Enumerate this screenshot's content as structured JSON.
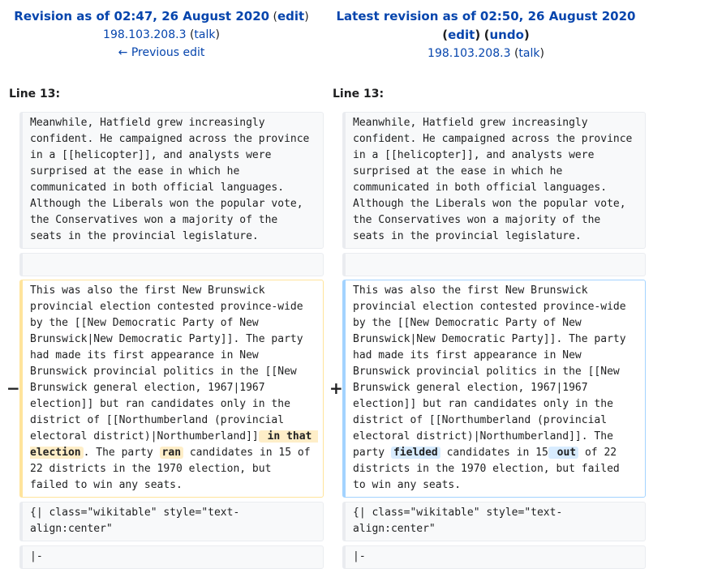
{
  "old_revision": {
    "title": "Revision as of 02:47, 26 August 2020",
    "edit_label": "edit",
    "user": "198.103.208.3",
    "talk_label": "talk",
    "prev_edit_label": "← Previous edit"
  },
  "new_revision": {
    "title": "Latest revision as of 02:50, 26 August 2020",
    "edit_label": "edit",
    "undo_label": "undo",
    "user": "198.103.208.3",
    "talk_label": "talk"
  },
  "line_label_left": "Line 13:",
  "line_label_right": "Line 13:",
  "context_paragraph": "Meanwhile, Hatfield grew increasingly confident. He campaigned across the province in a [[helicopter]], and analysts were surprised at the ease in which he communicated in both official languages. Although the Liberals won the popular vote, the Conservatives won a majority of the seats in the provincial legislature.",
  "markers": {
    "minus": "−",
    "plus": "+"
  },
  "deleted_line": {
    "part1": "This was also the first New Brunswick provincial election contested province-wide by the [[New Democratic Party of New Brunswick|New Democratic Party]]. The party had made its first appearance in New Brunswick provincial politics in the [[New Brunswick general election, 1967|1967 election]] but ran candidates only in the district of [[Northumberland (provincial electoral district)|Northumberland]]",
    "change1": " in that election",
    "part2": ". The party ",
    "change2": "ran",
    "part3": " candidates in 15 of 22 districts in the 1970 election, but failed to win any seats."
  },
  "added_line": {
    "part1": "This was also the first New Brunswick provincial election contested province-wide by the [[New Democratic Party of New Brunswick|New Democratic Party]]. The party had made its first appearance in New Brunswick provincial politics in the [[New Brunswick general election, 1967|1967 election]] but ran candidates only in the district of [[Northumberland (provincial electoral district)|Northumberland]]. The party ",
    "change1": "fielded",
    "part2": " candidates in 15",
    "change2": " out",
    "part3": " of 22 districts in the 1970 election, but failed to win any seats."
  },
  "table_start_line": "{| class=\"wikitable\" style=\"text-align:center\"",
  "row_sep_line": "|-"
}
